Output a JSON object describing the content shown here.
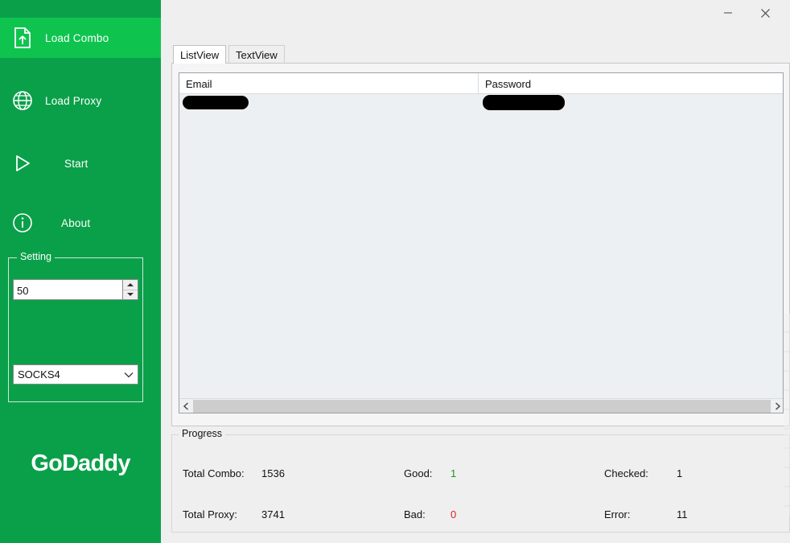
{
  "window": {
    "title": "",
    "minimize_label": "—",
    "close_label": "✕"
  },
  "sidebar": {
    "background_color": "#0aa04a",
    "selected_color": "#0ec44f",
    "items": [
      {
        "label": "Load Combo",
        "icon": "file-upload-icon",
        "selected": true
      },
      {
        "label": "Load Proxy",
        "icon": "globe-icon",
        "selected": false
      },
      {
        "label": "Start",
        "icon": "play-icon",
        "selected": false
      },
      {
        "label": "About",
        "icon": "info-icon",
        "selected": false
      }
    ],
    "setting_group": {
      "legend": "Setting",
      "thread_count": "50",
      "spinner_up_icon": "triangle-up-icon",
      "spinner_down_icon": "triangle-down-icon",
      "proxy_type": "SOCKS4",
      "proxy_chevron_icon": "chevron-down-icon"
    },
    "brand": "GoDaddy"
  },
  "main": {
    "tabs": [
      {
        "label": "ListView",
        "active": true
      },
      {
        "label": "TextView",
        "active": false
      }
    ],
    "listview": {
      "columns": [
        "Email",
        "Password"
      ],
      "rows": [
        {
          "email": "[REDACTED]",
          "password": "[REDACTED]"
        }
      ],
      "scrollbar": {
        "left_arrow_icon": "chevron-left-icon",
        "right_arrow_icon": "chevron-right-icon"
      }
    },
    "progress": {
      "legend": "Progress",
      "stats": [
        {
          "label": "Total Combo:",
          "value": "1536",
          "color": "#111111"
        },
        {
          "label": "Good:",
          "value": "1",
          "color": "#1a9a1a"
        },
        {
          "label": "Checked:",
          "value": "1",
          "color": "#111111"
        },
        {
          "label": "Total Proxy:",
          "value": "3741",
          "color": "#111111"
        },
        {
          "label": "Bad:",
          "value": "0",
          "color": "#e02020"
        },
        {
          "label": "Error:",
          "value": "11",
          "color": "#111111"
        }
      ]
    }
  }
}
